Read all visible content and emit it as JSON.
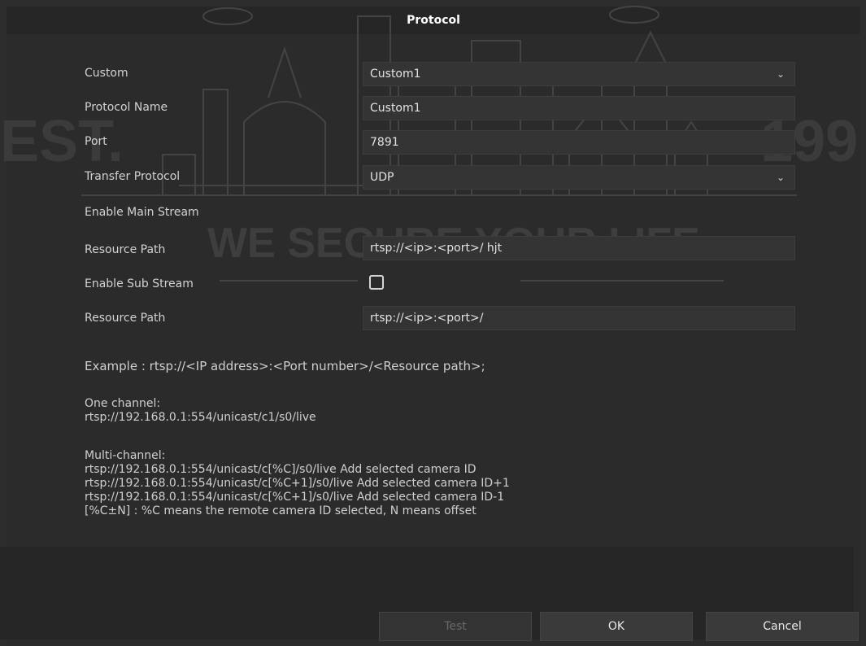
{
  "dialog": {
    "title": "Protocol"
  },
  "watermark": {
    "slogan": "WE SECURE YOUR LIFE",
    "left_text": "EST.",
    "right_text": "199"
  },
  "form": {
    "custom": {
      "label": "Custom",
      "value": "Custom1"
    },
    "protocol_name": {
      "label": "Protocol Name",
      "value": "Custom1"
    },
    "port": {
      "label": "Port",
      "value": "7891"
    },
    "transfer_protocol": {
      "label": "Transfer Protocol",
      "value": "UDP"
    },
    "enable_main_stream": {
      "label": "Enable Main Stream"
    },
    "main_resource_path": {
      "label": "Resource Path",
      "value": "rtsp://<ip>:<port>/ hjt"
    },
    "enable_sub_stream": {
      "label": "Enable Sub Stream",
      "checked": false
    },
    "sub_resource_path": {
      "label": "Resource Path",
      "value": "rtsp://<ip>:<port>/"
    }
  },
  "help": {
    "example": "Example : rtsp://<IP address>:<Port number>/<Resource path>;",
    "one_channel_title": "One channel:",
    "one_channel_url": "rtsp://192.168.0.1:554/unicast/c1/s0/live",
    "multi_channel_title": "Multi-channel:",
    "multi_line_1": "rtsp://192.168.0.1:554/unicast/c[%C]/s0/live Add selected camera ID",
    "multi_line_2": "rtsp://192.168.0.1:554/unicast/c[%C+1]/s0/live Add selected camera ID+1",
    "multi_line_3": "rtsp://192.168.0.1:554/unicast/c[%C+1]/s0/live Add selected camera ID-1",
    "multi_line_4": "[%C±N] : %C means the remote camera ID selected, N means offset"
  },
  "buttons": {
    "test": "Test",
    "ok": "OK",
    "cancel": "Cancel"
  }
}
